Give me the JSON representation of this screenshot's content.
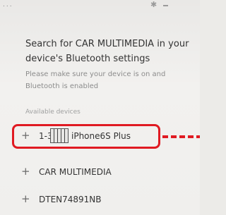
{
  "status_bar": {
    "dots": "...",
    "bluetooth_glyph": "✱"
  },
  "dialog": {
    "title": "Search for CAR MULTIMEDIA in your device's Bluetooth settings",
    "subtitle": "Please make sure your device is on and Bluetooth is enabled",
    "section_label": "Available devices"
  },
  "devices": [
    {
      "prefix": "1-3",
      "name": "iPhone6S Plus",
      "selected": true
    },
    {
      "name": "CAR MULTIMEDIA",
      "selected": false
    },
    {
      "name": "DTEN74891NB",
      "selected": false
    }
  ],
  "icons": {
    "add": "+",
    "status": "bluetooth-icon"
  },
  "colors": {
    "highlight": "#e01a22",
    "background": "#ecebe8"
  }
}
